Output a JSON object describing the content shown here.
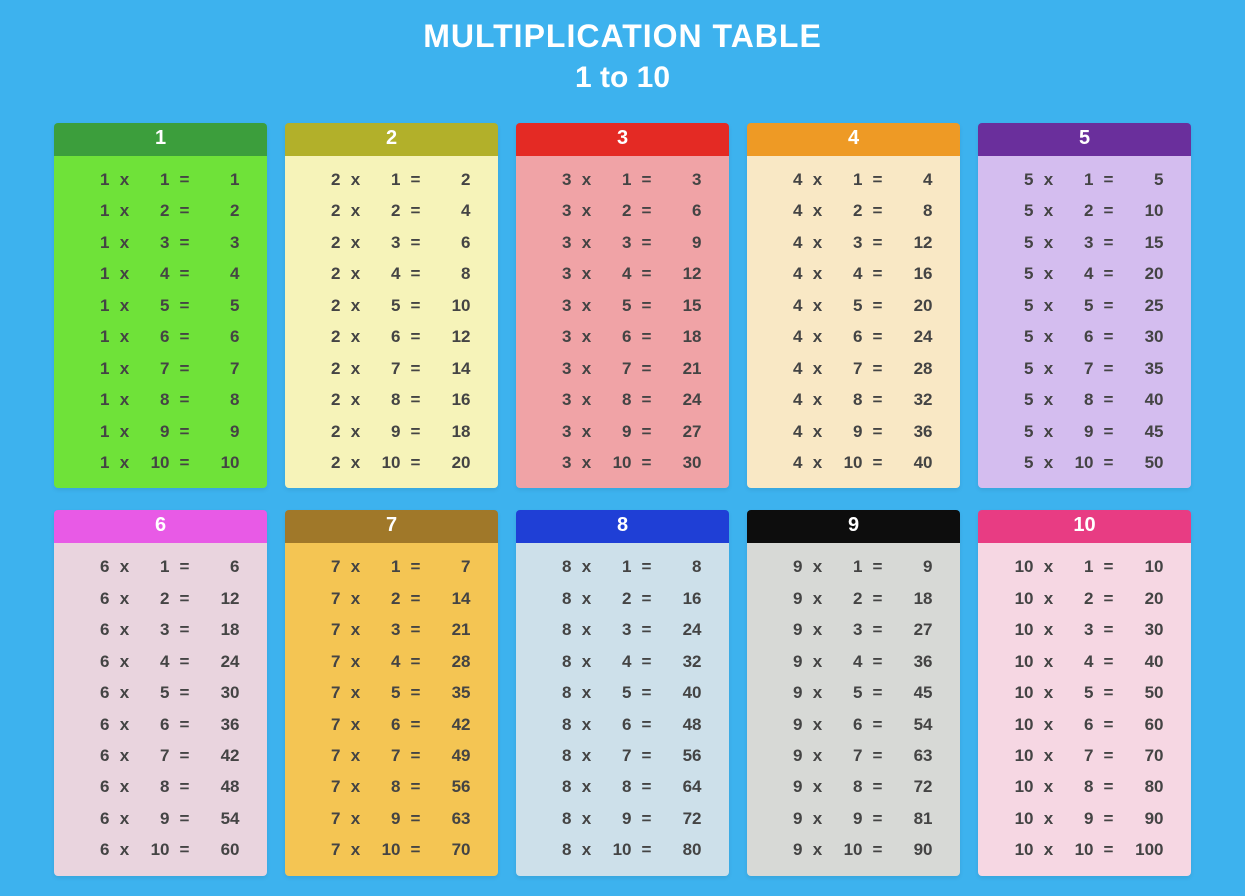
{
  "title": "MULTIPLICATION TABLE",
  "subtitle": "1 to 10",
  "sym_times": "x",
  "sym_eq": "=",
  "tables": [
    {
      "n": 1,
      "headerBg": "#3c9e3c",
      "bodyBg": "#6fe239",
      "rows": [
        [
          1,
          1,
          1
        ],
        [
          1,
          2,
          2
        ],
        [
          1,
          3,
          3
        ],
        [
          1,
          4,
          4
        ],
        [
          1,
          5,
          5
        ],
        [
          1,
          6,
          6
        ],
        [
          1,
          7,
          7
        ],
        [
          1,
          8,
          8
        ],
        [
          1,
          9,
          9
        ],
        [
          1,
          10,
          10
        ]
      ]
    },
    {
      "n": 2,
      "headerBg": "#b2b02a",
      "bodyBg": "#f6f3b9",
      "rows": [
        [
          2,
          1,
          2
        ],
        [
          2,
          2,
          4
        ],
        [
          2,
          3,
          6
        ],
        [
          2,
          4,
          8
        ],
        [
          2,
          5,
          10
        ],
        [
          2,
          6,
          12
        ],
        [
          2,
          7,
          14
        ],
        [
          2,
          8,
          16
        ],
        [
          2,
          9,
          18
        ],
        [
          2,
          10,
          20
        ]
      ]
    },
    {
      "n": 3,
      "headerBg": "#e42a24",
      "bodyBg": "#f0a3a6",
      "rows": [
        [
          3,
          1,
          3
        ],
        [
          3,
          2,
          6
        ],
        [
          3,
          3,
          9
        ],
        [
          3,
          4,
          12
        ],
        [
          3,
          5,
          15
        ],
        [
          3,
          6,
          18
        ],
        [
          3,
          7,
          21
        ],
        [
          3,
          8,
          24
        ],
        [
          3,
          9,
          27
        ],
        [
          3,
          10,
          30
        ]
      ]
    },
    {
      "n": 4,
      "headerBg": "#ee9a25",
      "bodyBg": "#f9e8c5",
      "rows": [
        [
          4,
          1,
          4
        ],
        [
          4,
          2,
          8
        ],
        [
          4,
          3,
          12
        ],
        [
          4,
          4,
          16
        ],
        [
          4,
          5,
          20
        ],
        [
          4,
          6,
          24
        ],
        [
          4,
          7,
          28
        ],
        [
          4,
          8,
          32
        ],
        [
          4,
          9,
          36
        ],
        [
          4,
          10,
          40
        ]
      ]
    },
    {
      "n": 5,
      "headerBg": "#6a2f9c",
      "bodyBg": "#d4bdef",
      "rows": [
        [
          5,
          1,
          5
        ],
        [
          5,
          2,
          10
        ],
        [
          5,
          3,
          15
        ],
        [
          5,
          4,
          20
        ],
        [
          5,
          5,
          25
        ],
        [
          5,
          6,
          30
        ],
        [
          5,
          7,
          35
        ],
        [
          5,
          8,
          40
        ],
        [
          5,
          9,
          45
        ],
        [
          5,
          10,
          50
        ]
      ]
    },
    {
      "n": 6,
      "headerBg": "#e85ae6",
      "bodyBg": "#e9d4de",
      "rows": [
        [
          6,
          1,
          6
        ],
        [
          6,
          2,
          12
        ],
        [
          6,
          3,
          18
        ],
        [
          6,
          4,
          24
        ],
        [
          6,
          5,
          30
        ],
        [
          6,
          6,
          36
        ],
        [
          6,
          7,
          42
        ],
        [
          6,
          8,
          48
        ],
        [
          6,
          9,
          54
        ],
        [
          6,
          10,
          60
        ]
      ]
    },
    {
      "n": 7,
      "headerBg": "#a07829",
      "bodyBg": "#f4c553",
      "rows": [
        [
          7,
          1,
          7
        ],
        [
          7,
          2,
          14
        ],
        [
          7,
          3,
          21
        ],
        [
          7,
          4,
          28
        ],
        [
          7,
          5,
          35
        ],
        [
          7,
          6,
          42
        ],
        [
          7,
          7,
          49
        ],
        [
          7,
          8,
          56
        ],
        [
          7,
          9,
          63
        ],
        [
          7,
          10,
          70
        ]
      ]
    },
    {
      "n": 8,
      "headerBg": "#1f3fd6",
      "bodyBg": "#cde0ea",
      "rows": [
        [
          8,
          1,
          8
        ],
        [
          8,
          2,
          16
        ],
        [
          8,
          3,
          24
        ],
        [
          8,
          4,
          32
        ],
        [
          8,
          5,
          40
        ],
        [
          8,
          6,
          48
        ],
        [
          8,
          7,
          56
        ],
        [
          8,
          8,
          64
        ],
        [
          8,
          9,
          72
        ],
        [
          8,
          10,
          80
        ]
      ]
    },
    {
      "n": 9,
      "headerBg": "#0d0d0d",
      "bodyBg": "#d7d9d6",
      "rows": [
        [
          9,
          1,
          9
        ],
        [
          9,
          2,
          18
        ],
        [
          9,
          3,
          27
        ],
        [
          9,
          4,
          36
        ],
        [
          9,
          5,
          45
        ],
        [
          9,
          6,
          54
        ],
        [
          9,
          7,
          63
        ],
        [
          9,
          8,
          72
        ],
        [
          9,
          9,
          81
        ],
        [
          9,
          10,
          90
        ]
      ]
    },
    {
      "n": 10,
      "headerBg": "#e83c83",
      "bodyBg": "#f6d7e3",
      "rows": [
        [
          10,
          1,
          10
        ],
        [
          10,
          2,
          20
        ],
        [
          10,
          3,
          30
        ],
        [
          10,
          4,
          40
        ],
        [
          10,
          5,
          50
        ],
        [
          10,
          6,
          60
        ],
        [
          10,
          7,
          70
        ],
        [
          10,
          8,
          80
        ],
        [
          10,
          9,
          90
        ],
        [
          10,
          10,
          100
        ]
      ]
    }
  ]
}
